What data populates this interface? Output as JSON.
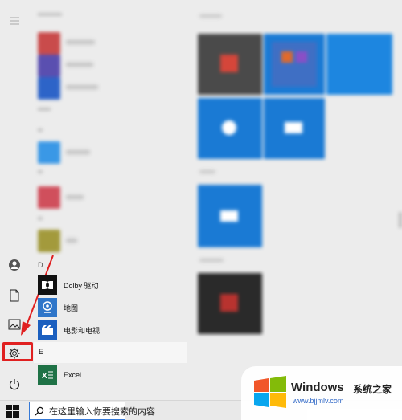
{
  "applist": {
    "letter_d": "D",
    "letter_e": "E",
    "apps": [
      {
        "label": "Dolby 驱动"
      },
      {
        "label": "地图"
      },
      {
        "label": "电影和电视"
      },
      {
        "label": "Excel"
      }
    ]
  },
  "taskbar": {
    "search_text": "在这里输入你要搜索的内容"
  },
  "watermark": {
    "brand": "Windows",
    "cn": "系统之家",
    "url": "www.bjjmlv.com"
  },
  "colors": {
    "accent": "#1a7ad4",
    "highlight_red": "#e02020"
  }
}
